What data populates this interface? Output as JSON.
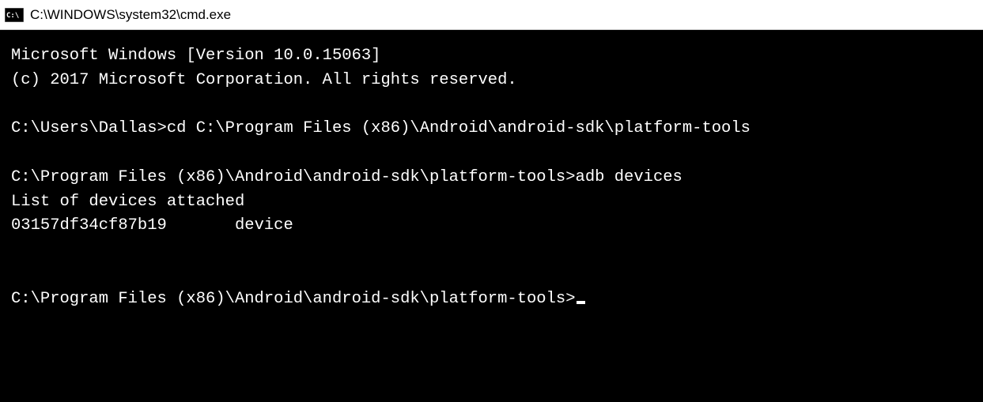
{
  "titlebar": {
    "title": "C:\\WINDOWS\\system32\\cmd.exe"
  },
  "terminal": {
    "line_version": "Microsoft Windows [Version 10.0.15063]",
    "line_copyright": "(c) 2017 Microsoft Corporation. All rights reserved.",
    "prompt1": "C:\\Users\\Dallas>",
    "command1": "cd C:\\Program Files (x86)\\Android\\android-sdk\\platform-tools",
    "prompt2": "C:\\Program Files (x86)\\Android\\android-sdk\\platform-tools>",
    "command2": "adb devices",
    "output_header": "List of devices attached",
    "device_id": "03157df34cf87b19",
    "device_status": "device",
    "prompt3": "C:\\Program Files (x86)\\Android\\android-sdk\\platform-tools>"
  }
}
